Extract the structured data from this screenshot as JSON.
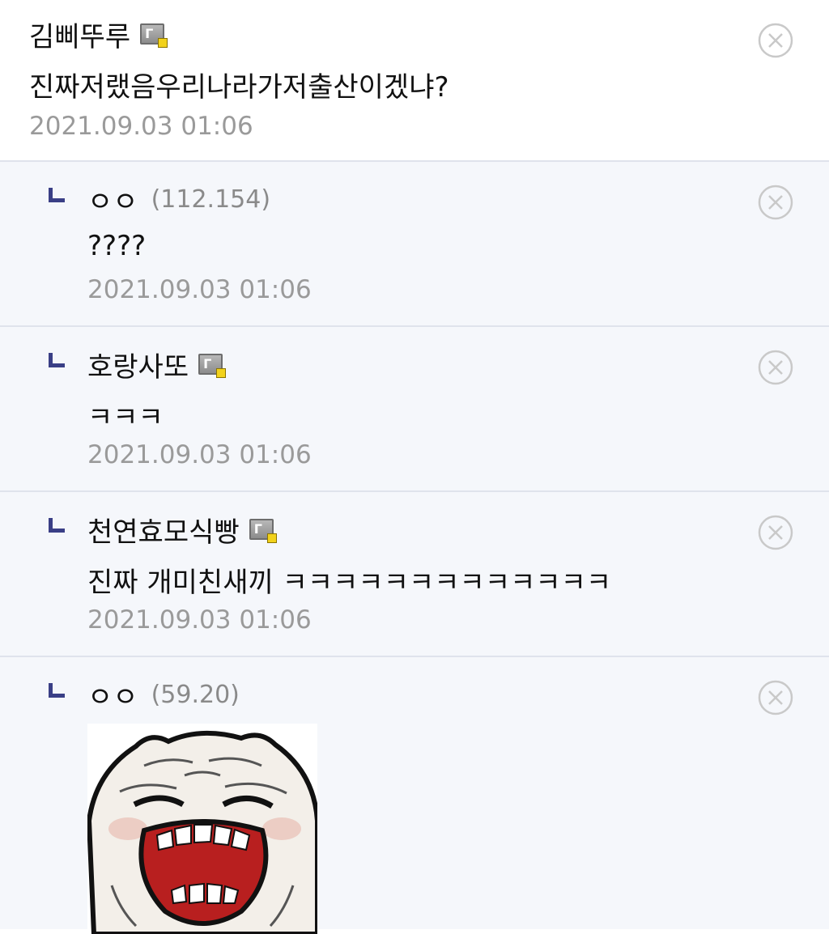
{
  "colors": {
    "reply_bg": "#f5f7fb",
    "divider": "#dfe3ec",
    "reply_mark": "#3a3f86",
    "time_text": "#9a9a9a",
    "ip_text": "#8a8a8a"
  },
  "comments": [
    {
      "nick": "김삐뚜루",
      "has_badge": true,
      "text": "진짜저랬음우리나라가저출산이겠냐?",
      "time": "2021.09.03 01:06"
    },
    {
      "nick": "ㅇㅇ",
      "ip": "(112.154)",
      "text": "????",
      "time": "2021.09.03 01:06"
    },
    {
      "nick": "호랑사또",
      "has_badge": true,
      "text": "ㅋㅋㅋ",
      "time": "2021.09.03 01:06"
    },
    {
      "nick": "천연효모식빵",
      "has_badge": true,
      "text": "진짜 개미친새끼 ㅋㅋㅋㅋㅋㅋㅋㅋㅋㅋㅋㅋㅋ",
      "time": "2021.09.03 01:06"
    },
    {
      "nick": "ㅇㅇ",
      "ip": "(59.20)",
      "sticker": "laughing-dumpling-sticker"
    }
  ],
  "icons": {
    "delete": "close-circle-icon",
    "reply": "reply-arrow-icon",
    "badge": "gallery-badge-icon"
  }
}
